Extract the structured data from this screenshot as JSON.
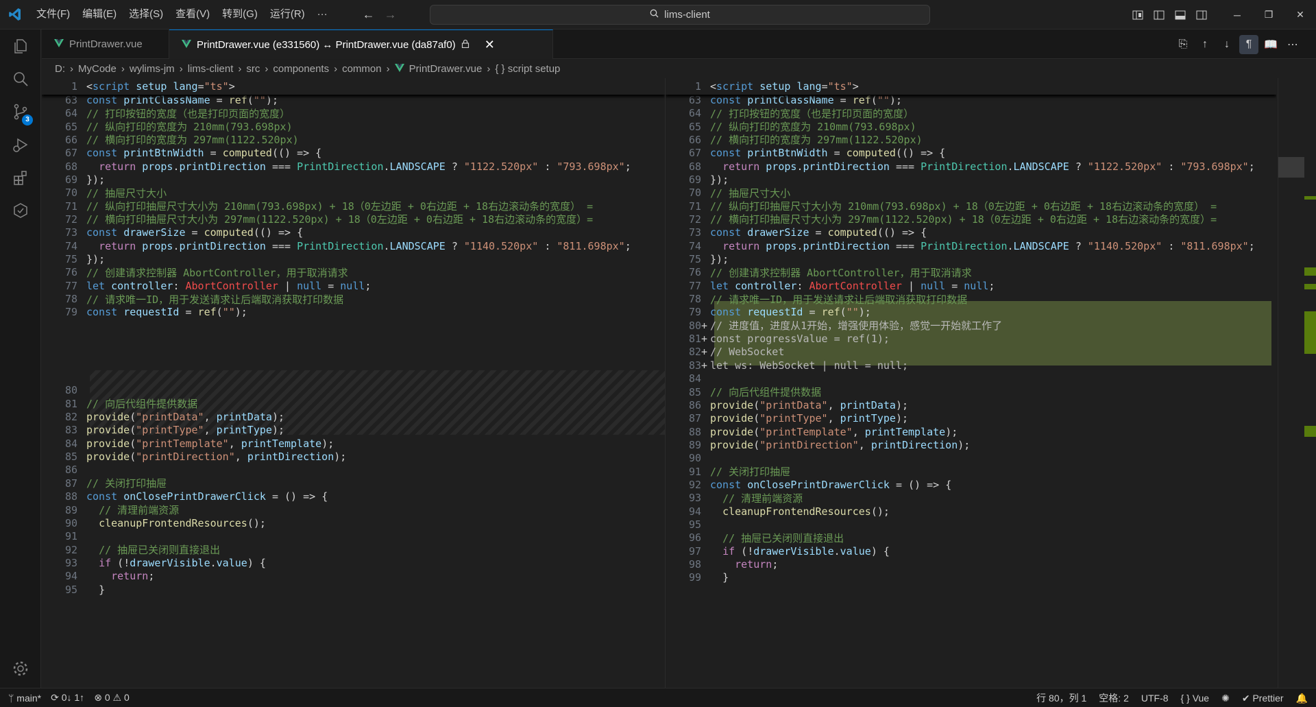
{
  "titlebar": {
    "menu": [
      "文件(F)",
      "编辑(E)",
      "选择(S)",
      "查看(V)",
      "转到(G)",
      "运行(R)",
      "···"
    ],
    "search": "lims-client"
  },
  "activity": {
    "scm_badge": "3"
  },
  "tabs": [
    {
      "label": "PrintDrawer.vue"
    },
    {
      "label": "PrintDrawer.vue (e331560) ↔ PrintDrawer.vue (da87af0)"
    }
  ],
  "breadcrumb": [
    "D:",
    "MyCode",
    "wylims-jm",
    "lims-client",
    "src",
    "components",
    "common",
    "PrintDrawer.vue",
    "{ } script setup"
  ],
  "left_lines": [
    {
      "n": "63",
      "t": "const printClassName = ref(\"\");"
    },
    {
      "n": "64",
      "t": "// 打印按钮的宽度（也是打印页面的宽度）"
    },
    {
      "n": "65",
      "t": "// 纵向打印的宽度为 210mm(793.698px)"
    },
    {
      "n": "66",
      "t": "// 横向打印的宽度为 297mm(1122.520px)"
    },
    {
      "n": "67",
      "t": "const printBtnWidth = computed(() => {"
    },
    {
      "n": "68",
      "t": "  return props.printDirection === PrintDirection.LANDSCAPE ? \"1122.520px\" : \"793.698px\";"
    },
    {
      "n": "69",
      "t": "});"
    },
    {
      "n": "70",
      "t": "// 抽屉尺寸大小"
    },
    {
      "n": "71",
      "t": "// 纵向打印抽屉尺寸大小为 210mm(793.698px) + 18（0左边距 + 0右边距 + 18右边滚动条的宽度） ="
    },
    {
      "n": "72",
      "t": "// 横向打印抽屉尺寸大小为 297mm(1122.520px) + 18（0左边距 + 0右边距 + 18右边滚动条的宽度）="
    },
    {
      "n": "73",
      "t": "const drawerSize = computed(() => {"
    },
    {
      "n": "74",
      "t": "  return props.printDirection === PrintDirection.LANDSCAPE ? \"1140.520px\" : \"811.698px\";"
    },
    {
      "n": "75",
      "t": "});"
    },
    {
      "n": "76",
      "t": "// 创建请求控制器 AbortController，用于取消请求"
    },
    {
      "n": "77",
      "t": "let controller: AbortController | null = null;"
    },
    {
      "n": "78",
      "t": "// 请求唯一ID，用于发送请求让后端取消获取打印数据"
    },
    {
      "n": "79",
      "t": "const requestId = ref(\"\");"
    },
    {
      "n": "80",
      "t": ""
    },
    {
      "n": "81",
      "t": "// 向后代组件提供数据"
    },
    {
      "n": "82",
      "t": "provide(\"printData\", printData);"
    },
    {
      "n": "83",
      "t": "provide(\"printType\", printType);"
    },
    {
      "n": "84",
      "t": "provide(\"printTemplate\", printTemplate);"
    },
    {
      "n": "85",
      "t": "provide(\"printDirection\", printDirection);"
    },
    {
      "n": "86",
      "t": ""
    },
    {
      "n": "87",
      "t": "// 关闭打印抽屉"
    },
    {
      "n": "88",
      "t": "const onClosePrintDrawerClick = () => {"
    },
    {
      "n": "89",
      "t": "  // 清理前端资源"
    },
    {
      "n": "90",
      "t": "  cleanupFrontendResources();"
    },
    {
      "n": "91",
      "t": ""
    },
    {
      "n": "92",
      "t": "  // 抽屉已关闭则直接退出"
    },
    {
      "n": "93",
      "t": "  if (!drawerVisible.value) {"
    },
    {
      "n": "94",
      "t": "    return;"
    },
    {
      "n": "95",
      "t": "  }"
    }
  ],
  "right_lines": [
    {
      "n": "63",
      "t": "const printClassName = ref(\"\");"
    },
    {
      "n": "64",
      "t": "// 打印按钮的宽度（也是打印页面的宽度）"
    },
    {
      "n": "65",
      "t": "// 纵向打印的宽度为 210mm(793.698px)"
    },
    {
      "n": "66",
      "t": "// 横向打印的宽度为 297mm(1122.520px)"
    },
    {
      "n": "67",
      "t": "const printBtnWidth = computed(() => {"
    },
    {
      "n": "68",
      "t": "  return props.printDirection === PrintDirection.LANDSCAPE ? \"1122.520px\" : \"793.698px\";"
    },
    {
      "n": "69",
      "t": "});"
    },
    {
      "n": "70",
      "t": "// 抽屉尺寸大小"
    },
    {
      "n": "71",
      "t": "// 纵向打印抽屉尺寸大小为 210mm(793.698px) + 18（0左边距 + 0右边距 + 18右边滚动条的宽度） ="
    },
    {
      "n": "72",
      "t": "// 横向打印抽屉尺寸大小为 297mm(1122.520px) + 18（0左边距 + 0右边距 + 18右边滚动条的宽度）="
    },
    {
      "n": "73",
      "t": "const drawerSize = computed(() => {"
    },
    {
      "n": "74",
      "t": "  return props.printDirection === PrintDirection.LANDSCAPE ? \"1140.520px\" : \"811.698px\";"
    },
    {
      "n": "75",
      "t": "});"
    },
    {
      "n": "76",
      "t": "// 创建请求控制器 AbortController，用于取消请求"
    },
    {
      "n": "77",
      "t": "let controller: AbortController | null = null;"
    },
    {
      "n": "78",
      "t": "// 请求唯一ID，用于发送请求让后端取消获取打印数据"
    },
    {
      "n": "79",
      "t": "const requestId = ref(\"\");"
    },
    {
      "n": "80",
      "t": "// 进度值，进度从1开始，增强使用体验，感觉一开始就工作了",
      "added": true
    },
    {
      "n": "81",
      "t": "const progressValue = ref(1);",
      "added": true
    },
    {
      "n": "82",
      "t": "// WebSocket",
      "added": true
    },
    {
      "n": "83",
      "t": "let ws: WebSocket | null = null;",
      "added": true
    },
    {
      "n": "84",
      "t": ""
    },
    {
      "n": "85",
      "t": "// 向后代组件提供数据"
    },
    {
      "n": "86",
      "t": "provide(\"printData\", printData);"
    },
    {
      "n": "87",
      "t": "provide(\"printType\", printType);"
    },
    {
      "n": "88",
      "t": "provide(\"printTemplate\", printTemplate);"
    },
    {
      "n": "89",
      "t": "provide(\"printDirection\", printDirection);"
    },
    {
      "n": "90",
      "t": ""
    },
    {
      "n": "91",
      "t": "// 关闭打印抽屉"
    },
    {
      "n": "92",
      "t": "const onClosePrintDrawerClick = () => {"
    },
    {
      "n": "93",
      "t": "  // 清理前端资源"
    },
    {
      "n": "94",
      "t": "  cleanupFrontendResources();"
    },
    {
      "n": "95",
      "t": ""
    },
    {
      "n": "96",
      "t": "  // 抽屉已关闭则直接退出"
    },
    {
      "n": "97",
      "t": "  if (!drawerVisible.value) {"
    },
    {
      "n": "98",
      "t": "    return;"
    },
    {
      "n": "99",
      "t": "  }"
    }
  ],
  "sticky": {
    "n": "1",
    "t": "<script setup lang=\"ts\">"
  },
  "status": {
    "branch": "main*",
    "sync": "0↓ 1↑",
    "errors": "0",
    "warnings": "0",
    "position": "行 80，列 1",
    "spaces": "空格: 2",
    "encoding": "UTF-8",
    "language": "Vue",
    "formatter": "Prettier"
  }
}
